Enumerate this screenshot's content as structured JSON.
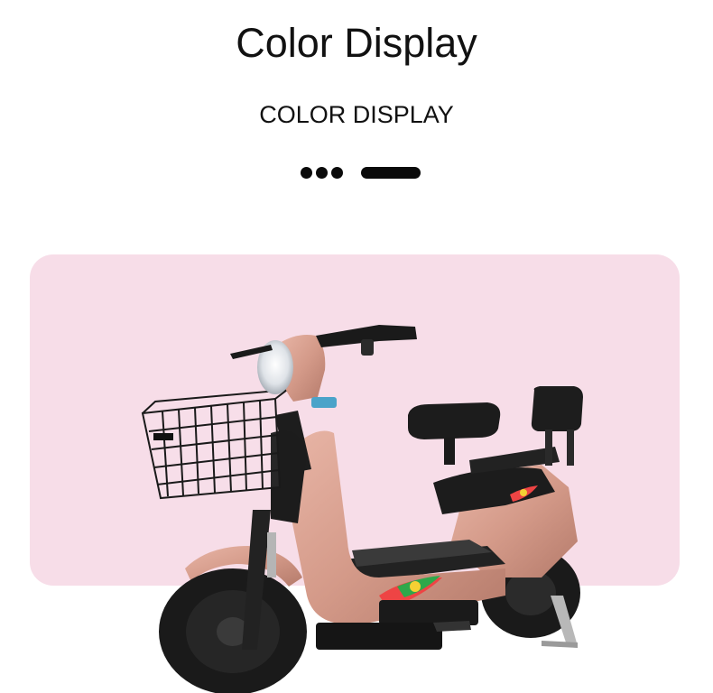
{
  "header": {
    "title": "Color Display",
    "subtitle": "COLOR DISPLAY"
  },
  "colors": {
    "panel_background": "#f7dde8",
    "scooter_body": "#d9a192",
    "text": "#111111"
  },
  "product_image": {
    "subject": "pink electric scooter with front wire basket"
  }
}
